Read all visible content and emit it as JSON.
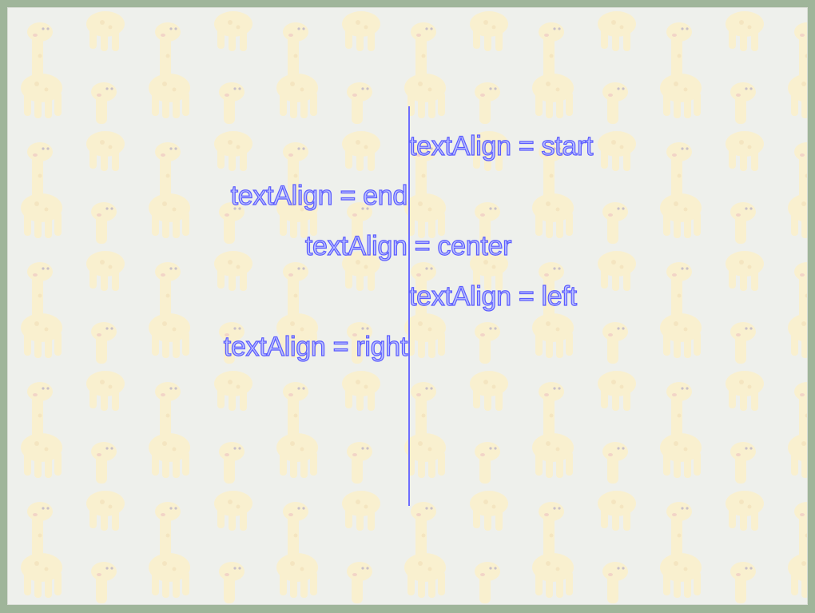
{
  "labels": {
    "start": "textAlign = start",
    "end": "textAlign = end",
    "center": "textAlign = center",
    "left": "textAlign = left",
    "right": "textAlign = right"
  },
  "colors": {
    "border": "#9fb59a",
    "background": "#eef0ec",
    "pattern": "#fdf3d4",
    "text_fill": "#b9bfff",
    "text_stroke": "#5b5bff",
    "guide_line": "#6d6dff"
  }
}
